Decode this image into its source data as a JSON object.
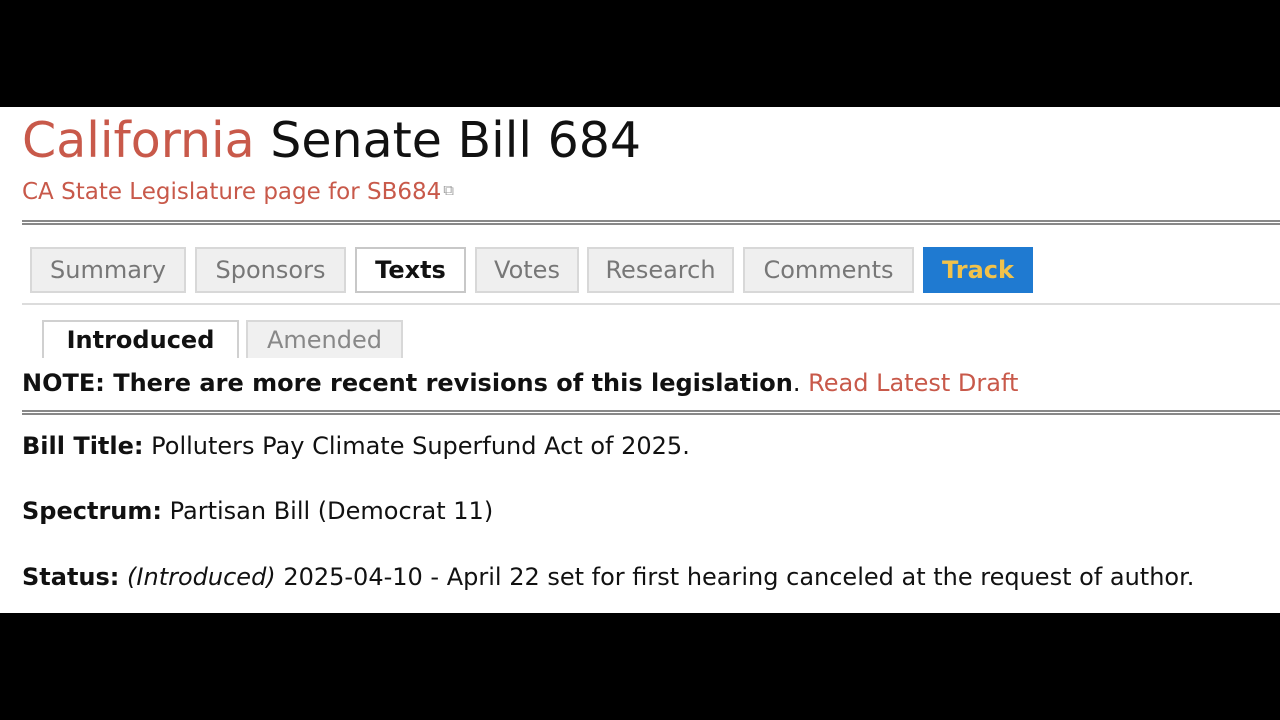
{
  "header": {
    "state": "California",
    "bill_name": "Senate Bill 684",
    "legislature_link": "CA State Legislature page for SB684",
    "external_icon": "external-link-icon"
  },
  "tabs": [
    {
      "label": "Summary"
    },
    {
      "label": "Sponsors"
    },
    {
      "label": "Texts",
      "active": true
    },
    {
      "label": "Votes"
    },
    {
      "label": "Research"
    },
    {
      "label": "Comments"
    },
    {
      "label": "Track",
      "highlight": true
    }
  ],
  "subtabs": [
    {
      "label": "Introduced",
      "active": true
    },
    {
      "label": "Amended"
    }
  ],
  "note": {
    "text": "NOTE: There are more recent revisions of this legislation",
    "punct": ".",
    "link": "Read Latest Draft"
  },
  "fields": {
    "bill_title": {
      "label": "Bill Title:",
      "value": "Polluters Pay Climate Superfund Act of 2025."
    },
    "spectrum": {
      "label": "Spectrum:",
      "value": "Partisan Bill (Democrat 11)"
    },
    "status": {
      "label": "Status:",
      "stage": "(Introduced)",
      "value": "2025-04-10 - April 22 set for first hearing canceled at the request of author."
    }
  },
  "colors": {
    "link": "#c8594a",
    "track_bg": "#1f7ad1",
    "track_text": "#f1c24b"
  }
}
